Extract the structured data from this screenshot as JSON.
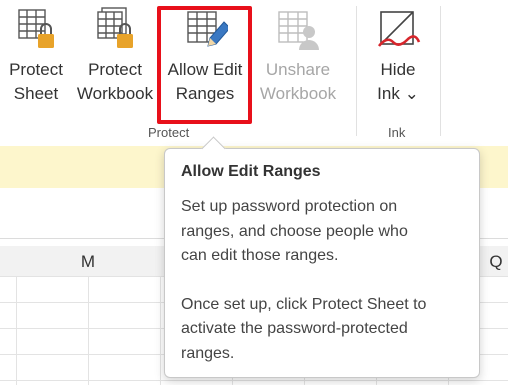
{
  "ribbon": {
    "buttons": [
      {
        "line1": "Protect",
        "line2": "Sheet",
        "icon": "protect-sheet-icon"
      },
      {
        "line1": "Protect",
        "line2": "Workbook",
        "icon": "protect-workbook-icon"
      },
      {
        "line1": "Allow Edit",
        "line2": "Ranges",
        "icon": "allow-edit-ranges-icon"
      },
      {
        "line1": "Unshare",
        "line2": "Workbook",
        "icon": "unshare-workbook-icon"
      },
      {
        "line1": "Hide",
        "line2": "Ink ⌄",
        "icon": "hide-ink-icon"
      }
    ],
    "groups": {
      "protect": "Protect",
      "ink": "Ink"
    }
  },
  "columns": {
    "m": "M",
    "q": "Q"
  },
  "tooltip": {
    "title": "Allow Edit Ranges",
    "para1": [
      "Set up password protection on",
      "ranges, and choose people who",
      "can edit those ranges."
    ],
    "para2": [
      "Once set up, click Protect Sheet to",
      "activate the password-protected",
      "ranges."
    ]
  },
  "colors": {
    "highlight": "#e8101a",
    "lock": "#e8a32a",
    "pen": "#3a78c2",
    "ink_red": "#d7262c",
    "infobar": "#fdf6cc"
  }
}
